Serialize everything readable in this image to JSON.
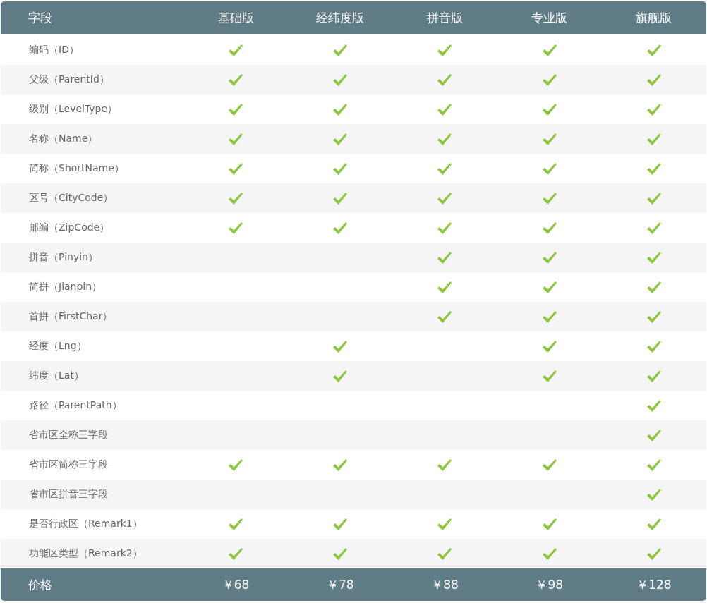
{
  "header": {
    "columns": [
      "字段",
      "基础版",
      "经纬度版",
      "拼音版",
      "专业版",
      "旗舰版"
    ]
  },
  "rows": [
    {
      "field": "编码（ID）",
      "checks": [
        true,
        true,
        true,
        true,
        true
      ]
    },
    {
      "field": "父级（ParentId）",
      "checks": [
        true,
        true,
        true,
        true,
        true
      ]
    },
    {
      "field": "级别（LevelType）",
      "checks": [
        true,
        true,
        true,
        true,
        true
      ]
    },
    {
      "field": "名称（Name）",
      "checks": [
        true,
        true,
        true,
        true,
        true
      ]
    },
    {
      "field": "简称（ShortName）",
      "checks": [
        true,
        true,
        true,
        true,
        true
      ]
    },
    {
      "field": "区号（CityCode）",
      "checks": [
        true,
        true,
        true,
        true,
        true
      ]
    },
    {
      "field": "邮编（ZipCode）",
      "checks": [
        true,
        true,
        true,
        true,
        true
      ]
    },
    {
      "field": "拼音（Pinyin）",
      "checks": [
        false,
        false,
        true,
        true,
        true
      ]
    },
    {
      "field": "简拼（Jianpin）",
      "checks": [
        false,
        false,
        true,
        true,
        true
      ]
    },
    {
      "field": "首拼（FirstChar）",
      "checks": [
        false,
        false,
        true,
        true,
        true
      ]
    },
    {
      "field": "经度（Lng）",
      "checks": [
        false,
        true,
        false,
        true,
        true
      ]
    },
    {
      "field": "纬度（Lat）",
      "checks": [
        false,
        true,
        false,
        true,
        true
      ]
    },
    {
      "field": "路径（ParentPath）",
      "checks": [
        false,
        false,
        false,
        false,
        true
      ]
    },
    {
      "field": "省市区全称三字段",
      "checks": [
        false,
        false,
        false,
        false,
        true
      ]
    },
    {
      "field": "省市区简称三字段",
      "checks": [
        true,
        true,
        true,
        true,
        true
      ]
    },
    {
      "field": "省市区拼音三字段",
      "checks": [
        false,
        false,
        false,
        false,
        true
      ]
    },
    {
      "field": "是否行政区（Remark1）",
      "checks": [
        true,
        true,
        true,
        true,
        true
      ]
    },
    {
      "field": "功能区类型（Remark2）",
      "checks": [
        true,
        true,
        true,
        true,
        true
      ]
    }
  ],
  "footer": {
    "label": "价格",
    "prices": [
      "￥68",
      "￥78",
      "￥88",
      "￥98",
      "￥128"
    ]
  }
}
